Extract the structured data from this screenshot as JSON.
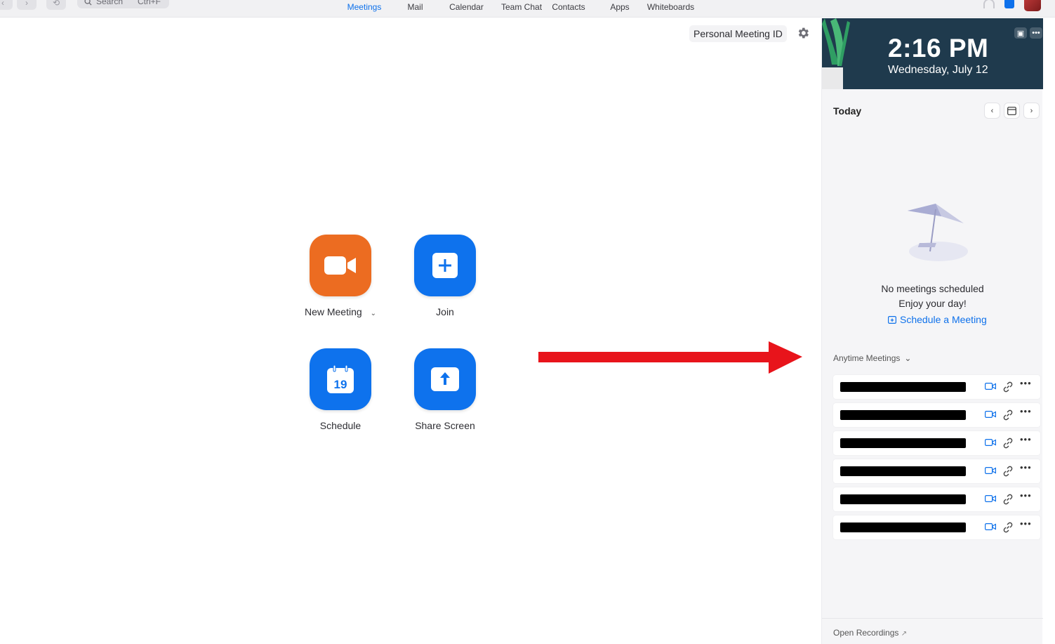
{
  "topbar": {
    "search_placeholder": "Search",
    "search_shortcut": "Ctrl+F",
    "tabs": [
      {
        "label": "Meetings",
        "active": true
      },
      {
        "label": "Mail",
        "active": false
      },
      {
        "label": "Calendar",
        "active": false
      },
      {
        "label": "Team Chat",
        "active": false
      },
      {
        "label": "Contacts",
        "active": false
      },
      {
        "label": "Apps",
        "active": false
      },
      {
        "label": "Whiteboards",
        "active": false
      }
    ],
    "icons": [
      "back-icon",
      "forward-icon",
      "history-icon",
      "search-icon",
      "bell-icon",
      "app-icon",
      "avatar"
    ]
  },
  "main": {
    "personal_meeting_id_label": "Personal Meeting ID",
    "actions": {
      "new_meeting": "New Meeting",
      "join": "Join",
      "schedule": "Schedule",
      "schedule_day": "19",
      "share_screen": "Share Screen"
    }
  },
  "panel": {
    "clock": {
      "time": "2:16 PM",
      "date": "Wednesday, July 12"
    },
    "today_label": "Today",
    "empty_title": "No meetings scheduled",
    "empty_subtitle": "Enjoy your day!",
    "schedule_link": "Schedule a Meeting",
    "anytime_label": "Anytime Meetings",
    "meeting_count": 6,
    "open_recordings": "Open Recordings"
  },
  "colors": {
    "accent": "#0e71eb",
    "orange_tile": "#ec6c21",
    "blue_tile": "#0e72ed",
    "arrow": "#e8141b",
    "clock_bg": "#1f3a4d"
  }
}
